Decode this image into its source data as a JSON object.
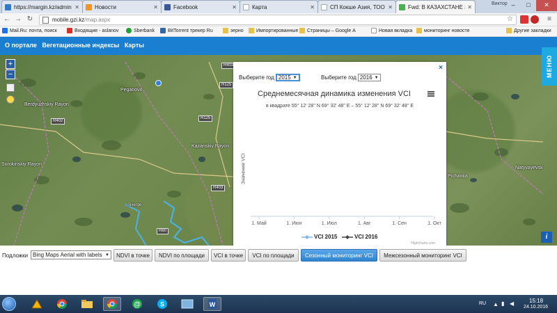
{
  "browser": {
    "tabs": [
      {
        "title": "https://margin.kz/admin",
        "color": "#2b7bd0"
      },
      {
        "title": "Новости",
        "color": "#f7931e"
      },
      {
        "title": "Facebook",
        "color": "#3b5998"
      },
      {
        "title": "Карта",
        "color": "#ffffff"
      },
      {
        "title": "СП Кокше Азия, ТОО и",
        "color": "#dddddd"
      },
      {
        "title": "Fwd: В КАЗАХСТАНЕ 3А",
        "color": "#4caf50"
      }
    ],
    "user_label": "Виктор",
    "window_controls": {
      "minimize": "–",
      "maximize": "□",
      "close": "✕"
    },
    "url_host": "mobile.gzi.kz",
    "url_path": "/map.aspx",
    "bookmarks": [
      {
        "label": "Mail.Ru: почта, поиск",
        "color": "#1a73e8",
        "folder": false
      },
      {
        "label": "Входящие - aslanov",
        "color": "#d93025",
        "folder": false
      },
      {
        "label": "Sberbank",
        "color": "#21a038",
        "folder": false
      },
      {
        "label": "BitTorrent трекер Ru",
        "color": "#3466a1",
        "folder": false
      },
      {
        "label": "зерно",
        "color": "#e6c24a",
        "folder": true
      },
      {
        "label": "Импортированные",
        "color": "#e6c24a",
        "folder": true
      },
      {
        "label": "Страницы – Google А",
        "color": "#e6c24a",
        "folder": true
      },
      {
        "label": "Новая вкладка",
        "color": "#9e9e9e",
        "folder": false
      },
      {
        "label": "мониторинг новосте",
        "color": "#e6c24a",
        "folder": true
      }
    ],
    "other_bookmarks": "Другие закладки"
  },
  "site": {
    "nav": [
      "О портале",
      "Вегетационные индексы",
      "Карты"
    ],
    "menu_label": "МЕНЮ",
    "colors": {
      "header": "#1a7fd1",
      "menu": "#1eaae0",
      "active_button": "#2f85d1"
    }
  },
  "map": {
    "zoom_in": "+",
    "zoom_out": "−",
    "labels": {
      "peganovo": "Peganovo",
      "berdyuzhsky": "Berdyuzhskiy Rayon",
      "kazansky": "Kazanskiy Rayon",
      "sorokinsky": "Sorokinskiy Rayon",
      "natyvayevsk": "Natyvayevsk",
      "pichanka": "Pichanka",
      "sivergi": "Siverge"
    },
    "road_shields": [
      "R403",
      "R125",
      "R125",
      "R402",
      "R403",
      "R60"
    ],
    "info_label": "i"
  },
  "popup": {
    "close_label": "×",
    "year1_label": "Выберите год",
    "year1_value": "2015",
    "year2_label": "Выберите год",
    "year2_value": "2016",
    "credit": "Highcharts.com"
  },
  "chart_data": {
    "type": "line",
    "title": "Среднемесячная динамика изменения VCI",
    "subtitle": "в квадрате 55° 12' 28'' N 69° 32' 48'' E – 55° 12' 28'' N 69° 32' 48'' E",
    "ylabel": "Значение VCI",
    "xlabel": "",
    "categories": [
      "1. Май",
      "1. Июн",
      "1. Июл",
      "1. Авг",
      "1. Сен",
      "1. Окт"
    ],
    "series": [
      {
        "name": "VCI 2015",
        "values": [],
        "color": "#7cb5ec",
        "marker": "diamond"
      },
      {
        "name": "VCI 2016",
        "values": [],
        "color": "#434348",
        "marker": "diamond"
      }
    ],
    "legend_position": "bottom-center",
    "grid": false
  },
  "toolbar": {
    "layers_label": "Подложки",
    "layers_value": "Bing Maps Aerial with labels",
    "buttons": [
      {
        "label": "NDVI в точке",
        "active": false
      },
      {
        "label": "NDVI по площади",
        "active": false
      },
      {
        "label": "VCI в точке",
        "active": false
      },
      {
        "label": "VCI по площади",
        "active": false
      },
      {
        "label": "Сезонный мониторинг VCI",
        "active": true
      },
      {
        "label": "Межсезонный мониторинг VCI",
        "active": false
      }
    ]
  },
  "taskbar": {
    "lang": "RU",
    "time": "15:18",
    "date": "24.10.2016"
  }
}
